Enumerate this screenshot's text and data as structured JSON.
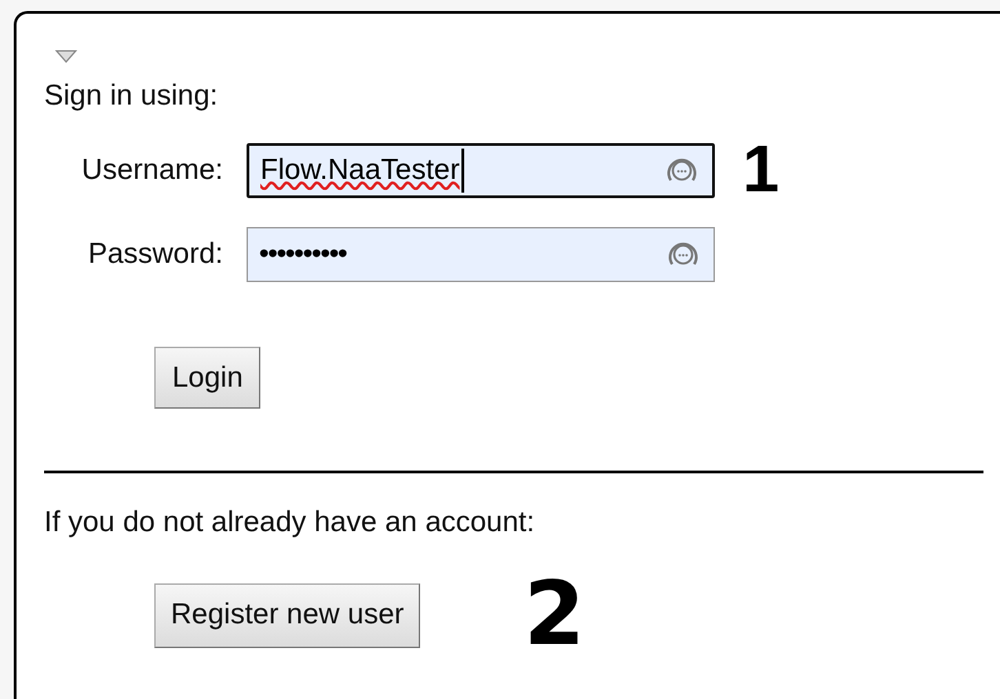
{
  "collapsed": false,
  "heading": "Sign in using:",
  "fields": [
    {
      "label": "Username:",
      "value": "Flow.NaaTester",
      "kind": "text",
      "focused": true,
      "misspelled": true
    },
    {
      "label": "Password:",
      "value": "••••••••••",
      "kind": "password",
      "focused": false,
      "misspelled": false
    }
  ],
  "login_button": "Login",
  "register_prompt": "If you do not already have an account:",
  "register_button": "Register new user",
  "annotations": [
    "1",
    "2"
  ]
}
